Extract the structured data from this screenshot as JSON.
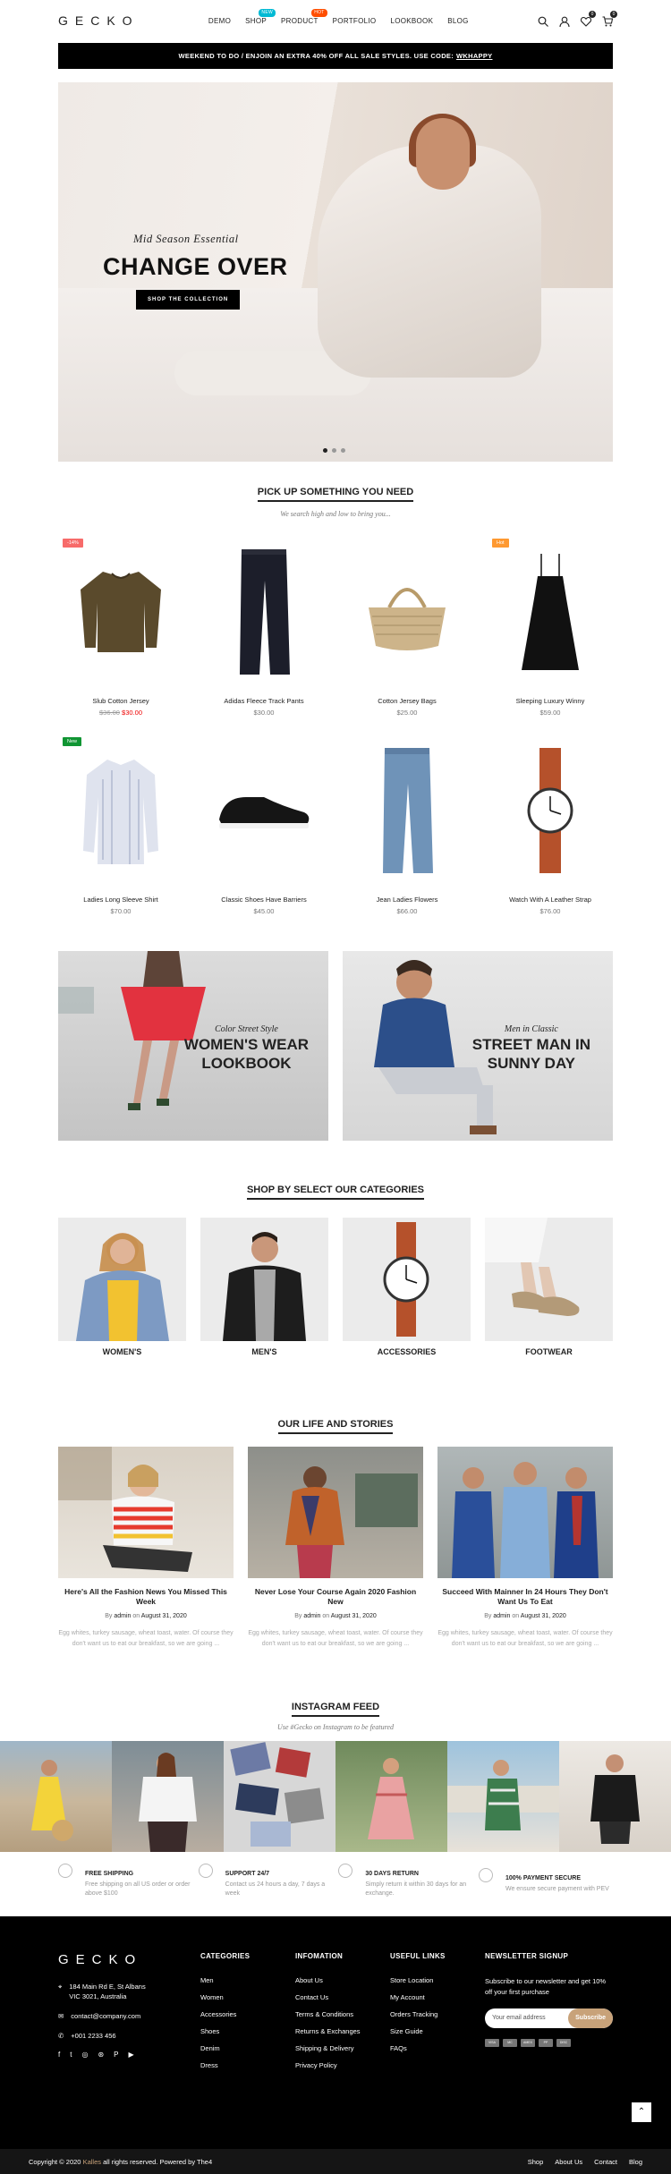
{
  "header": {
    "logo": "GECKO",
    "nav": [
      {
        "label": "DEMO",
        "badge": ""
      },
      {
        "label": "SHOP",
        "badge": "NEW",
        "badge_color": "#01bad4"
      },
      {
        "label": "PRODUCT",
        "badge": "HOT",
        "badge_color": "#ff4e00"
      },
      {
        "label": "PORTFOLIO",
        "badge": ""
      },
      {
        "label": "LOOKBOOK",
        "badge": ""
      },
      {
        "label": "BLOG",
        "badge": ""
      }
    ],
    "wishlist_count": "0",
    "cart_count": "0",
    "icons": [
      "search-icon",
      "user-icon",
      "heart-icon",
      "cart-icon"
    ]
  },
  "promo": {
    "text": "WEEKEND TO DO / ENJOIN AN EXTRA 40% OFF ALL SALE STYLES. USE CODE:",
    "code": "WKHAPPY"
  },
  "hero": {
    "subtitle": "Mid Season Essential",
    "title": "CHANGE OVER",
    "button": "SHOP THE COLLECTION",
    "slides": 3,
    "active_slide": 1
  },
  "products_section": {
    "title": "PICK UP SOMETHING YOU NEED",
    "subtitle": "We search high and low to bring you...",
    "products": [
      {
        "name": "Slub Cotton Jersey",
        "old_price": "$36.00",
        "price": "$30.00",
        "label": "-14%",
        "label_color": "#f76b6a"
      },
      {
        "name": "Adidas Fleece Track Pants",
        "old_price": "",
        "price": "$30.00",
        "label": ""
      },
      {
        "name": "Cotton Jersey Bags",
        "old_price": "",
        "price": "$25.00",
        "label": ""
      },
      {
        "name": "Sleeping Luxury Winny",
        "old_price": "",
        "price": "$59.00",
        "label": "Hot",
        "label_color": "#fe9931"
      },
      {
        "name": "Ladies Long Sleeve Shirt",
        "old_price": "",
        "price": "$70.00",
        "label": "New",
        "label_color": "#109533"
      },
      {
        "name": "Classic Shoes Have Barriers",
        "old_price": "",
        "price": "$45.00",
        "label": ""
      },
      {
        "name": "Jean Ladies Flowers",
        "old_price": "",
        "price": "$66.00",
        "label": ""
      },
      {
        "name": "Watch With A Leather Strap",
        "old_price": "",
        "price": "$76.00",
        "label": ""
      }
    ]
  },
  "banners": [
    {
      "subtitle": "Color Street Style",
      "title_line1": "WOMEN'S WEAR",
      "title_line2": "LOOKBOOK"
    },
    {
      "subtitle": "Men in Classic",
      "title_line1": "STREET MAN IN",
      "title_line2": "SUNNY DAY"
    }
  ],
  "categories_section": {
    "title": "SHOP BY SELECT OUR CATEGORIES",
    "items": [
      "WOMEN'S",
      "MEN'S",
      "ACCESSORIES",
      "FOOTWEAR"
    ]
  },
  "blog_section": {
    "title": "OUR LIFE AND STORIES",
    "by": "By",
    "on": "on",
    "posts": [
      {
        "title": "Here's All the Fashion News You Missed This Week",
        "author": "admin",
        "date": "August 31, 2020",
        "excerpt": "Egg whites, turkey sausage, wheat toast, water. Of course they don't want us to eat our breakfast, so we are going ..."
      },
      {
        "title": "Never Lose Your Course Again 2020 Fashion New",
        "author": "admin",
        "date": "August 31, 2020",
        "excerpt": "Egg whites, turkey sausage, wheat toast, water. Of course they don't want us to eat our breakfast, so we are going ..."
      },
      {
        "title": "Succeed With Mainner In 24 Hours They Don't Want Us To Eat",
        "author": "admin",
        "date": "August 31, 2020",
        "excerpt": "Egg whites, turkey sausage, wheat toast, water. Of course they don't want us to eat our breakfast, so we are going ..."
      }
    ]
  },
  "instagram": {
    "title": "INSTAGRAM FEED",
    "subtitle": "Use #Gecko on Instagram to be featured",
    "count": 6
  },
  "features": [
    {
      "icon": "truck-icon",
      "title": "FREE SHIPPING",
      "text": "Free shipping on all US order or order above $100"
    },
    {
      "icon": "support-icon",
      "title": "SUPPORT 24/7",
      "text": "Contact us 24 hours a day, 7 days a week"
    },
    {
      "icon": "return-icon",
      "title": "30 DAYS RETURN",
      "text": "Simply return it within 30 days for an exchange."
    },
    {
      "icon": "shield-icon",
      "title": "100% PAYMENT SECURE",
      "text": "We ensure secure payment with PEV"
    }
  ],
  "footer": {
    "logo": "GECKO",
    "address": "184 Main Rd E, St Albans VIC 3021, Australia",
    "email": "contact@company.com",
    "phone": "+001 2233 456",
    "social": [
      "facebook-icon",
      "twitter-icon",
      "instagram-icon",
      "dribbble-icon",
      "pinterest-icon",
      "youtube-icon"
    ],
    "columns": [
      {
        "title": "CATEGORIES",
        "links": [
          "Men",
          "Women",
          "Accessories",
          "Shoes",
          "Denim",
          "Dress"
        ]
      },
      {
        "title": "INFOMATION",
        "links": [
          "About Us",
          "Contact Us",
          "Terms & Conditions",
          "Returns & Exchanges",
          "Shipping & Delivery",
          "Privacy Policy"
        ]
      },
      {
        "title": "USEFUL LINKS",
        "links": [
          "Store Location",
          "My Account",
          "Orders Tracking",
          "Size Guide",
          "FAQs"
        ]
      }
    ],
    "newsletter": {
      "title": "NEWSLETTER SIGNUP",
      "text": "Subscribe to our newsletter and get 10% off your first purchase",
      "placeholder": "Your email address",
      "button": "Subscribe"
    },
    "payments": [
      "VISA",
      "MC",
      "AMEX",
      "PP",
      "DISC"
    ],
    "copyright_pre": "Copyright © 2020",
    "copyright_brand": "Kalles",
    "copyright_post": "all rights reserved. Powered by The4",
    "bottom_links": [
      "Shop",
      "About Us",
      "Contact",
      "Blog"
    ]
  },
  "colors": {
    "accent": "#c8a279",
    "sale": "#e00000",
    "dark": "#000000"
  }
}
